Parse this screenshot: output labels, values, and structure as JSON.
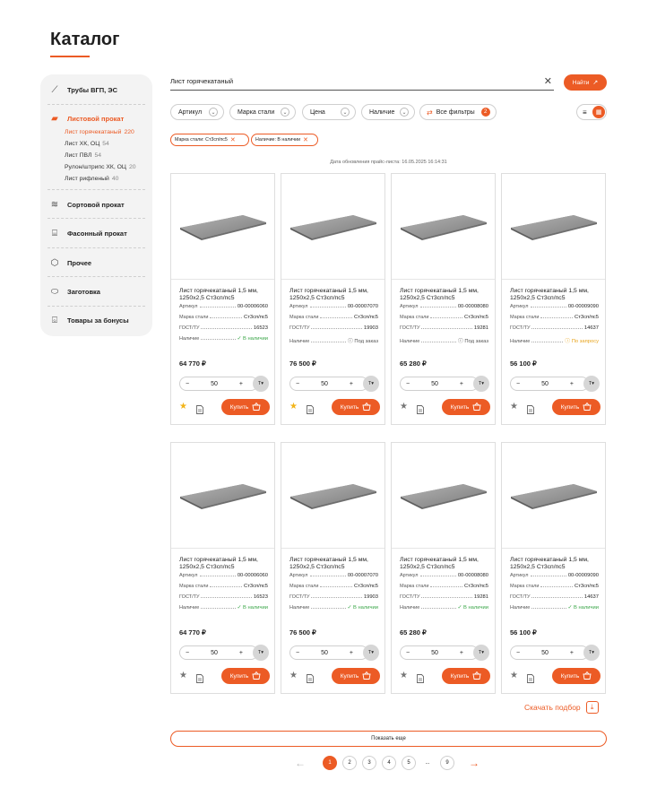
{
  "page_title": "Каталог",
  "accent": "#ec5b25",
  "sidebar": {
    "sections": [
      {
        "label": "Трубы ВГП, ЭС",
        "icon": "pipe-icon",
        "active": false
      },
      {
        "label": "Листовой прокат",
        "icon": "sheet-stack-icon",
        "active": true
      },
      {
        "label": "Сортовой прокат",
        "icon": "rebar-icon",
        "active": false
      },
      {
        "label": "Фасонный прокат",
        "icon": "beam-icon",
        "active": false
      },
      {
        "label": "Прочее",
        "icon": "misc-icon",
        "active": false
      },
      {
        "label": "Заготовка",
        "icon": "billet-icon",
        "active": false
      },
      {
        "label": "Товары за бонусы",
        "icon": "gift-icon",
        "active": false
      }
    ],
    "subitems": [
      {
        "label": "Лист горячекатаный",
        "count": "220",
        "active": true
      },
      {
        "label": "Лист ХК, ОЦ",
        "count": "54",
        "active": false
      },
      {
        "label": "Лист ПВЛ",
        "count": "54",
        "active": false
      },
      {
        "label": "Рулон/штрипс ХК, ОЦ",
        "count": "20",
        "active": false
      },
      {
        "label": "Лист рифленый",
        "count": "40",
        "active": false
      }
    ]
  },
  "search": {
    "value": "Лист горячекатаный",
    "button_label": "Найти"
  },
  "filters": {
    "dropdowns": [
      "Артикул",
      "Марка стали",
      "Цена",
      "Наличие"
    ],
    "all_filters_label": "Все фильтры",
    "all_filters_count": "2",
    "active_tags": [
      "Марка стали: Ст3сп/пс5",
      "Наличие: В наличии"
    ]
  },
  "price_update": "Дата обновления прайс-листа: 16.05.2025 16:14:31",
  "card_labels": {
    "article": "Артикул",
    "steel": "Марка стали",
    "gost": "ГОСТ/ТУ",
    "stock": "Наличие",
    "buy": "Купить",
    "unit": "Т"
  },
  "products": [
    {
      "name": "Лист горячекатаный 1,5 мм, 1250х2,5 Ст3сп/пс5",
      "article": "00-00006060",
      "steel": "Ст3сп/пс5",
      "gost": "16523",
      "stock": "В наличии",
      "stock_status": "ok",
      "price": "64 770 ₽",
      "qty": "50",
      "favorite": true
    },
    {
      "name": "Лист горячекатаный 1,5 мм, 1250х2,5 Ст3сп/пс5",
      "article": "00-00007070",
      "steel": "Ст3сп/пс5",
      "gost": "19903",
      "stock": "Под заказ",
      "stock_status": "wait",
      "price": "76 500 ₽",
      "qty": "50",
      "favorite": true
    },
    {
      "name": "Лист горячекатаный 1,5 мм, 1250х2,5 Ст3сп/пс5",
      "article": "00-00008080",
      "steel": "Ст3сп/пс5",
      "gost": "19281",
      "stock": "Под заказ",
      "stock_status": "wait",
      "price": "65 280 ₽",
      "qty": "50",
      "favorite": false
    },
    {
      "name": "Лист горячекатаный 1,5 мм, 1250х2,5 Ст3сп/пс5",
      "article": "00-00009090",
      "steel": "Ст3сп/пс5",
      "gost": "14637",
      "stock": "По запросу",
      "stock_status": "req",
      "price": "56 100 ₽",
      "qty": "50",
      "favorite": false
    },
    {
      "name": "Лист горячекатаный 1,5 мм, 1250х2,5 Ст3сп/пс5",
      "article": "00-00006060",
      "steel": "Ст3сп/пс5",
      "gost": "16523",
      "stock": "В наличии",
      "stock_status": "ok",
      "price": "64 770 ₽",
      "qty": "50",
      "favorite": false
    },
    {
      "name": "Лист горячекатаный 1,5 мм, 1250х2,5 Ст3сп/пс5",
      "article": "00-00007070",
      "steel": "Ст3сп/пс5",
      "gost": "19903",
      "stock": "В наличии",
      "stock_status": "ok",
      "price": "76 500 ₽",
      "qty": "50",
      "favorite": false
    },
    {
      "name": "Лист горячекатаный 1,5 мм, 1250х2,5 Ст3сп/пс5",
      "article": "00-00008080",
      "steel": "Ст3сп/пс5",
      "gost": "19281",
      "stock": "В наличии",
      "stock_status": "ok",
      "price": "65 280 ₽",
      "qty": "50",
      "favorite": false
    },
    {
      "name": "Лист горячекатаный 1,5 мм, 1250х2,5 Ст3сп/пс5",
      "article": "00-00009090",
      "steel": "Ст3сп/пс5",
      "gost": "14637",
      "stock": "В наличии",
      "stock_status": "ok",
      "price": "56 100 ₽",
      "qty": "50",
      "favorite": false
    }
  ],
  "download_label": "Скачать подбор",
  "show_more_label": "Показать еще",
  "pagination": {
    "pages": [
      "1",
      "2",
      "3",
      "4",
      "5",
      "...",
      "9"
    ],
    "current": "1"
  }
}
